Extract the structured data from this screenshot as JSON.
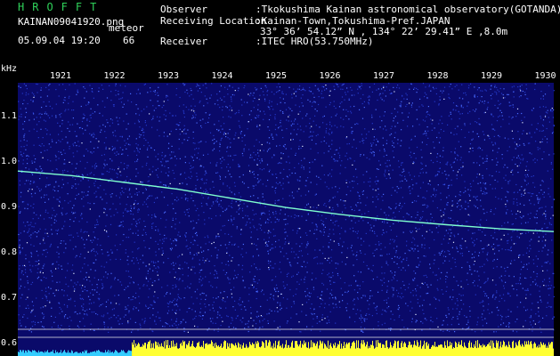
{
  "header": {
    "app_title": "HROFFT",
    "filename": "KAINAN09041920.png",
    "meteor_label": "meteor",
    "timestamp": "05.09.04 19:20",
    "meteor_count": "66",
    "observer_label": "Observer",
    "observer_value": ":Tkokushima Kainan astronomical observatory(GOTANDA)",
    "location_label": "Receiving Location",
    "location_value": ":Kainan-Town,Tokushima-Pref.JAPAN",
    "coordinates": "33° 36’ 54.12” N , 134° 22’ 29.41” E ,8.0m",
    "receiver_label": "Receiver",
    "receiver_value": ":ITEC HRO(53.750MHz)"
  },
  "chart_data": {
    "type": "heatmap",
    "ylabel": "kHz",
    "yticks": [
      "1.1",
      "1.0",
      "0.9",
      "0.8",
      "0.7",
      "0.6"
    ],
    "ylim": [
      0.58,
      1.18
    ],
    "xticks": [
      "1921",
      "1922",
      "1923",
      "1924",
      "1925",
      "1926",
      "1927",
      "1928",
      "1929",
      "1930"
    ],
    "trace": {
      "x": [
        1920.0,
        1921.0,
        1922.0,
        1923.0,
        1924.0,
        1925.0,
        1926.0,
        1927.0,
        1928.0,
        1929.0,
        1930.0
      ],
      "y": [
        0.98,
        0.97,
        0.955,
        0.94,
        0.92,
        0.9,
        0.885,
        0.872,
        0.862,
        0.853,
        0.847
      ]
    },
    "colors": {
      "background": "#0a0a6a",
      "noise": "#3a5cff",
      "trace": "#7fffd0",
      "bars": "#ffff33",
      "bars_low": "#33ccff",
      "reference_lines": "#e8e8e8"
    }
  }
}
